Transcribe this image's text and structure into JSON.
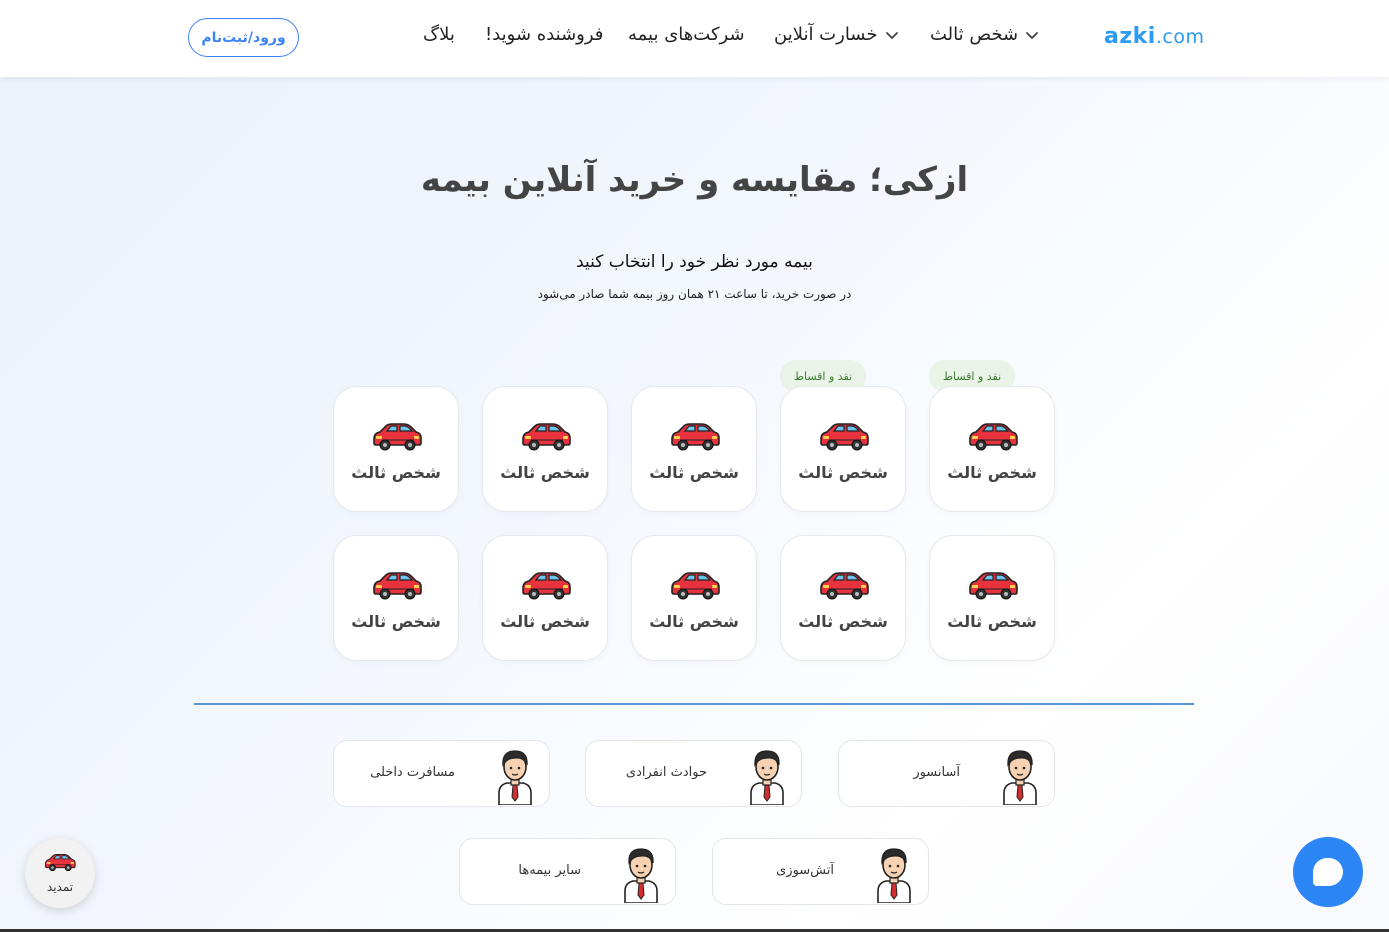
{
  "header": {
    "logo_main": "azki",
    "logo_suffix": ".com",
    "nav": [
      {
        "label": "شخص ثالث",
        "has_dropdown": true
      },
      {
        "label": "خسارت آنلاین",
        "has_dropdown": true
      },
      {
        "label": "شرکت‌های بیمه",
        "has_dropdown": false
      },
      {
        "label": "فروشنده شوید!",
        "has_dropdown": false
      },
      {
        "label": "بلاگ",
        "has_dropdown": false
      }
    ],
    "login_label": "ورود/ثبت‌نام"
  },
  "hero": {
    "title": "ازکی؛ مقایسه و خرید آنلاین بیمه",
    "subtitle": "بیمه مورد نظر خود را انتخاب کنید",
    "note": "در صورت خرید، تا ساعت ۲۱ همان روز بیمه شما صادر می‌شود"
  },
  "products": [
    {
      "label": "شخص ثالث",
      "badge": "نقد و اقساط",
      "icon": "car-icon"
    },
    {
      "label": "شخص ثالث",
      "badge": "نقد و اقساط",
      "icon": "car-icon"
    },
    {
      "label": "شخص ثالث",
      "badge": "",
      "icon": "car-icon"
    },
    {
      "label": "شخص ثالث",
      "badge": "",
      "icon": "car-icon"
    },
    {
      "label": "شخص ثالث",
      "badge": "",
      "icon": "car-icon"
    },
    {
      "label": "شخص ثالث",
      "badge": "",
      "icon": "car-icon"
    },
    {
      "label": "شخص ثالث",
      "badge": "",
      "icon": "car-icon"
    },
    {
      "label": "شخص ثالث",
      "badge": "",
      "icon": "car-icon"
    },
    {
      "label": "شخص ثالث",
      "badge": "",
      "icon": "car-icon"
    },
    {
      "label": "شخص ثالث",
      "badge": "",
      "icon": "car-icon"
    }
  ],
  "other_insurances": [
    {
      "label": "آسانسور",
      "icon": "person-icon"
    },
    {
      "label": "حوادث انفرادی",
      "icon": "person-icon"
    },
    {
      "label": "مسافرت داخلی",
      "icon": "person-icon"
    },
    {
      "label": "آتش‌سوزی",
      "icon": "person-icon"
    },
    {
      "label": "سایر بیمه‌ها",
      "icon": "person-icon"
    }
  ],
  "renew_button": {
    "label": "تمدید",
    "icon": "car-icon"
  },
  "chat_button": {
    "icon": "chat-bubble-icon"
  },
  "colors": {
    "brand": "#2b9bf4",
    "login_border": "#3b82f6",
    "badge_bg": "#e9f3e7",
    "badge_text": "#3b7a2e",
    "divider": "#5b95d6",
    "chat": "#2d86f5",
    "car_body": "#e8333f"
  }
}
